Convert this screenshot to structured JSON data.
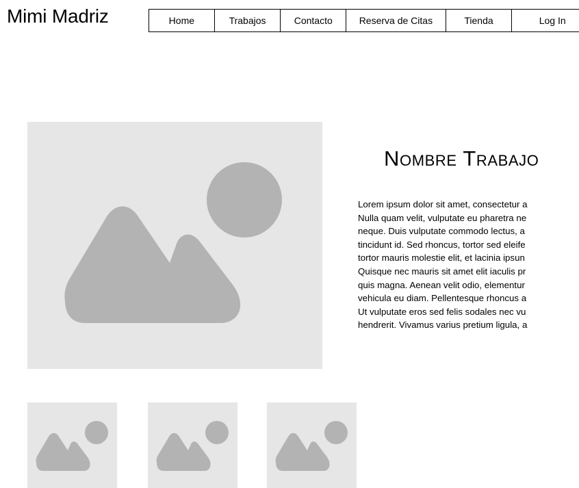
{
  "header": {
    "site_title": "Mimi Madriz"
  },
  "nav": {
    "items": [
      {
        "label": "Home"
      },
      {
        "label": "Trabajos"
      },
      {
        "label": "Contacto"
      },
      {
        "label": "Reserva de Citas"
      },
      {
        "label": "Tienda"
      },
      {
        "label": "Log In"
      }
    ]
  },
  "work": {
    "title": "Nombre Trabajo",
    "description_lines": [
      "Lorem ipsum dolor sit amet, consectetur a",
      "Nulla quam velit, vulputate eu pharetra ne",
      "neque. Duis vulputate commodo lectus, a",
      "tincidunt id. Sed rhoncus, tortor sed eleife",
      "tortor mauris molestie elit, et lacinia ipsun",
      "Quisque nec mauris sit amet elit iaculis pr",
      "quis magna. Aenean velit odio, elementur",
      "vehicula eu diam. Pellentesque rhoncus a",
      "Ut vulputate eros sed felis sodales nec vu",
      "hendrerit. Vivamus varius pretium ligula, a"
    ]
  },
  "images": {
    "main_icon": "image-placeholder-icon",
    "thumbnail_icon": "image-placeholder-icon",
    "placeholder_bg": "#e6e6e6",
    "placeholder_fg": "#b3b3b3"
  }
}
